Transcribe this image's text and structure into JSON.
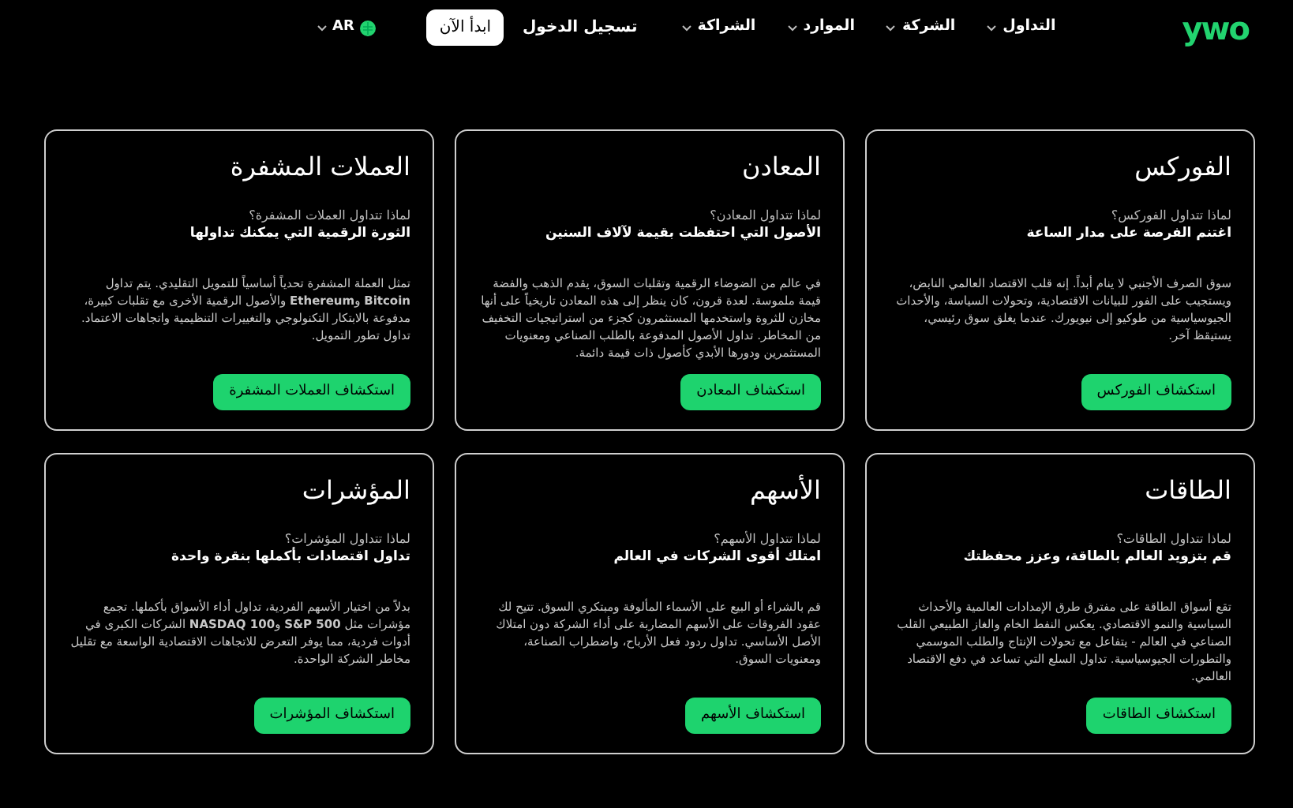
{
  "nav": {
    "logo": "ywo",
    "menu": [
      {
        "label": "التداول",
        "has_dropdown": true
      },
      {
        "label": "الشركة",
        "has_dropdown": true
      },
      {
        "label": "الموارد",
        "has_dropdown": true
      },
      {
        "label": "الشراكة",
        "has_dropdown": true
      }
    ],
    "login": "تسجيل الدخول",
    "start": "ابدأ الآن",
    "language": "AR"
  },
  "cards": [
    {
      "title": "الفوركس",
      "question": "لماذا تتداول الفوركس؟",
      "tagline": "اغتنم الفرصة على مدار الساعة",
      "body": "سوق الصرف الأجنبي لا ينام أبداً. إنه قلب الاقتصاد العالمي النابض، ويستجيب على الفور للبيانات الاقتصادية، وتحولات السياسة، والأحداث الجيوسياسية من طوكيو إلى نيويورك. عندما يغلق سوق رئيسي، يستيقظ آخر.",
      "button": "استكشاف الفوركس"
    },
    {
      "title": "المعادن",
      "question": "لماذا تتداول المعادن؟",
      "tagline": "الأصول التي احتفظت بقيمة لآلاف السنين",
      "body": "في عالم من الضوضاء الرقمية وتقلبات السوق، يقدم الذهب والفضة قيمة ملموسة. لعدة قرون، كان ينظر إلى هذه المعادن تاريخياً على أنها مخازن للثروة واستخدمها المستثمرون كجزء من استراتيجيات التخفيف من المخاطر. تداول الأصول المدفوعة بالطلب الصناعي ومعنويات المستثمرين ودورها الأبدي كأصول ذات قيمة دائمة.",
      "button": "استكشاف المعادن"
    },
    {
      "title": "العملات المشفرة",
      "question": "لماذا تتداول العملات المشفرة؟",
      "tagline": "الثورة الرقمية التي يمكنك تداولها",
      "body": "تمثل العملة المشفرة تحدياً أساسياً للتمويل التقليدي. يتم تداول **Bitcoin** و**Ethereum** والأصول الرقمية الأخرى مع تقلبات كبيرة، مدفوعة بالابتكار التكنولوجي والتغييرات التنظيمية واتجاهات الاعتماد. تداول تطور التمويل.",
      "button": "استكشاف العملات المشفرة"
    },
    {
      "title": "الطاقات",
      "question": "لماذا تتداول الطاقات؟",
      "tagline": "قم بتزويد العالم بالطاقة، وعزز محفظتك",
      "body": "تقع أسواق الطاقة على مفترق طرق الإمدادات العالمية والأحداث السياسية والنمو الاقتصادي. يعكس النفط الخام والغاز الطبيعي القلب الصناعي في العالم - يتفاعل مع تحولات الإنتاج والطلب الموسمي والتطورات الجيوسياسية. تداول السلع التي تساعد في دفع الاقتصاد العالمي.",
      "button": "استكشاف الطاقات"
    },
    {
      "title": "الأسهم",
      "question": "لماذا تتداول الأسهم؟",
      "tagline": "امتلك أقوى الشركات في العالم",
      "body": "قم بالشراء أو البيع على الأسماء المألوفة ومبتكري السوق. تتيح لك عقود الفروقات على الأسهم المضاربة على أداء الشركة دون امتلاك الأصل الأساسي. تداول ردود فعل الأرباح، واضطراب الصناعة، ومعنويات السوق.",
      "button": "استكشاف الأسهم"
    },
    {
      "title": "المؤشرات",
      "question": "لماذا تتداول المؤشرات؟",
      "tagline": "تداول اقتصادات بأكملها بنقرة واحدة",
      "body": "بدلاً من اختيار الأسهم الفردية، تداول أداء الأسواق بأكملها. تجمع مؤشرات مثل **S&P 500** و**NASDAQ 100** الشركات الكبرى في أدوات فردية، مما يوفر التعرض للاتجاهات الاقتصادية الواسعة مع تقليل مخاطر الشركة الواحدة.",
      "button": "استكشاف المؤشرات"
    }
  ]
}
